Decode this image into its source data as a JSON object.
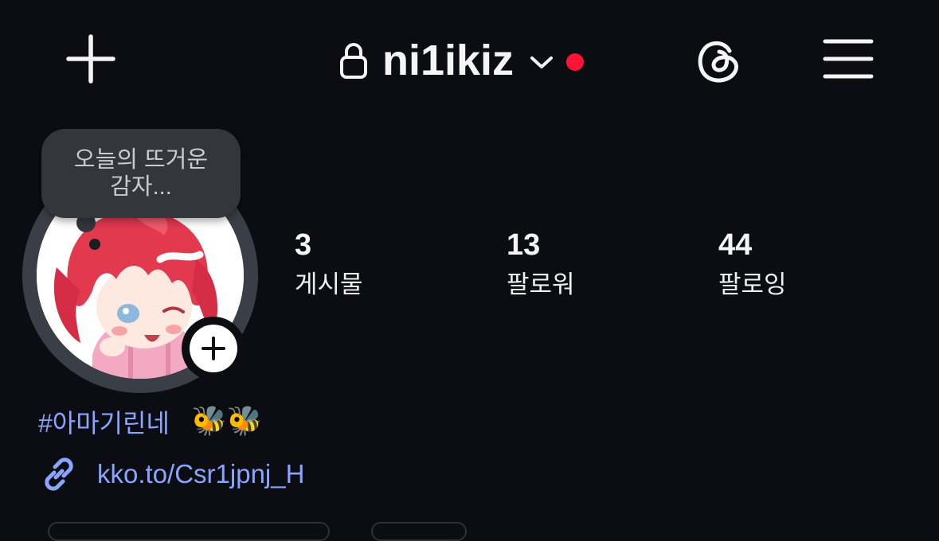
{
  "header": {
    "create_icon": "plus-icon",
    "lock_icon": "lock-icon",
    "username": "ni1ikiz",
    "switch_icon": "chevron-down-icon",
    "notification_color": "#ff1436",
    "threads_icon": "threads-icon",
    "menu_icon": "hamburger-menu-icon"
  },
  "profile": {
    "note": "오늘의 뜨거운 감자...",
    "add_story_icon": "plus-icon"
  },
  "stats": [
    {
      "value": "3",
      "label": "게시물"
    },
    {
      "value": "13",
      "label": "팔로워"
    },
    {
      "value": "44",
      "label": "팔로잉"
    }
  ],
  "bio": {
    "hashtag": "#아마기린네",
    "emoji": "🐝🐝",
    "link_icon": "link-icon",
    "link": "kko.to/Csr1jpnj_H"
  },
  "colors": {
    "background": "#0b0d12",
    "link": "#8aa5ff"
  }
}
